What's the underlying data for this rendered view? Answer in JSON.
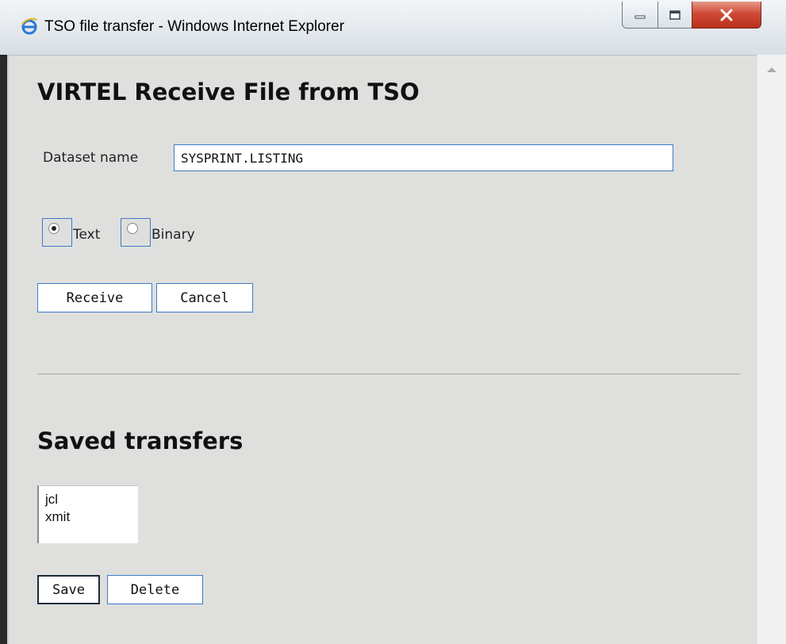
{
  "window": {
    "title": "TSO file transfer - Windows Internet Explorer",
    "icons": [
      "ie-icon",
      "minimize-icon",
      "maximize-icon",
      "close-icon"
    ]
  },
  "receive": {
    "heading": "VIRTEL Receive File from TSO",
    "dataset_label": "Dataset name",
    "dataset_value": "SYSPRINT.LISTING",
    "mode_options": [
      {
        "label": "Text",
        "selected": true
      },
      {
        "label": "Binary",
        "selected": false
      }
    ],
    "receive_button": "Receive",
    "cancel_button": "Cancel"
  },
  "saved": {
    "heading": "Saved transfers",
    "items": [
      "jcl",
      "xmit"
    ],
    "save_button": "Save",
    "delete_button": "Delete"
  },
  "colors": {
    "accent_border": "#3d7bc9",
    "page_background": "#dfe0dd",
    "close_button": "#cf4b36"
  }
}
